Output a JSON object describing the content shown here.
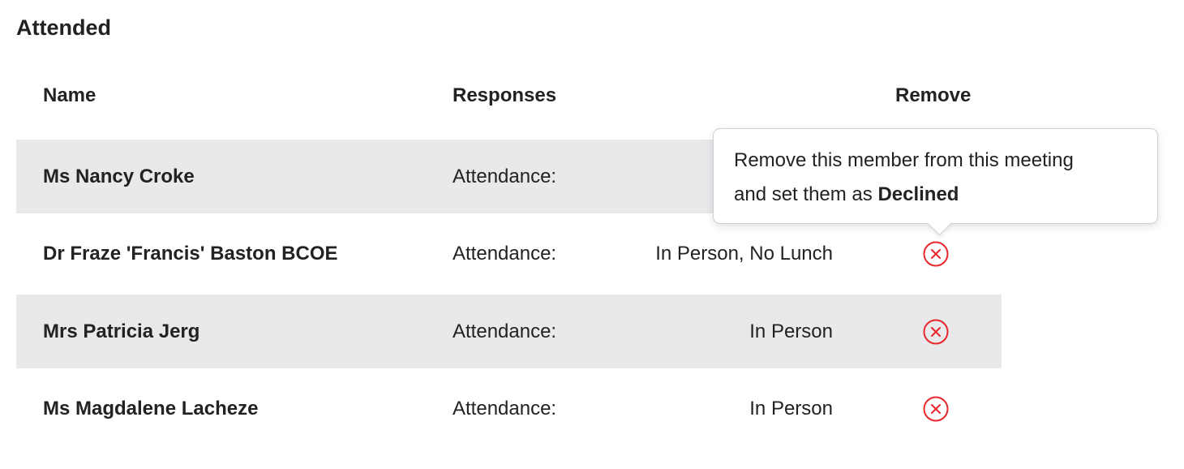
{
  "section": {
    "title": "Attended"
  },
  "table": {
    "headers": {
      "name": "Name",
      "responses": "Responses",
      "remove": "Remove"
    },
    "rows": [
      {
        "name": "Ms Nancy Croke",
        "label": "Attendance:",
        "value": ""
      },
      {
        "name": "Dr Fraze 'Francis' Baston BCOE",
        "label": "Attendance:",
        "value": "In Person, No Lunch"
      },
      {
        "name": "Mrs Patricia Jerg",
        "label": "Attendance:",
        "value": "In Person"
      },
      {
        "name": "Ms Magdalene Lacheze",
        "label": "Attendance:",
        "value": "In Person"
      }
    ]
  },
  "tooltip": {
    "line1": "Remove this member from this meeting",
    "line2_prefix": "and set them as ",
    "line2_bold": "Declined"
  },
  "colors": {
    "remove_icon": "#e8262b",
    "row_shade": "#e9e9eb"
  },
  "icons": {
    "remove": "close-circle-icon"
  }
}
